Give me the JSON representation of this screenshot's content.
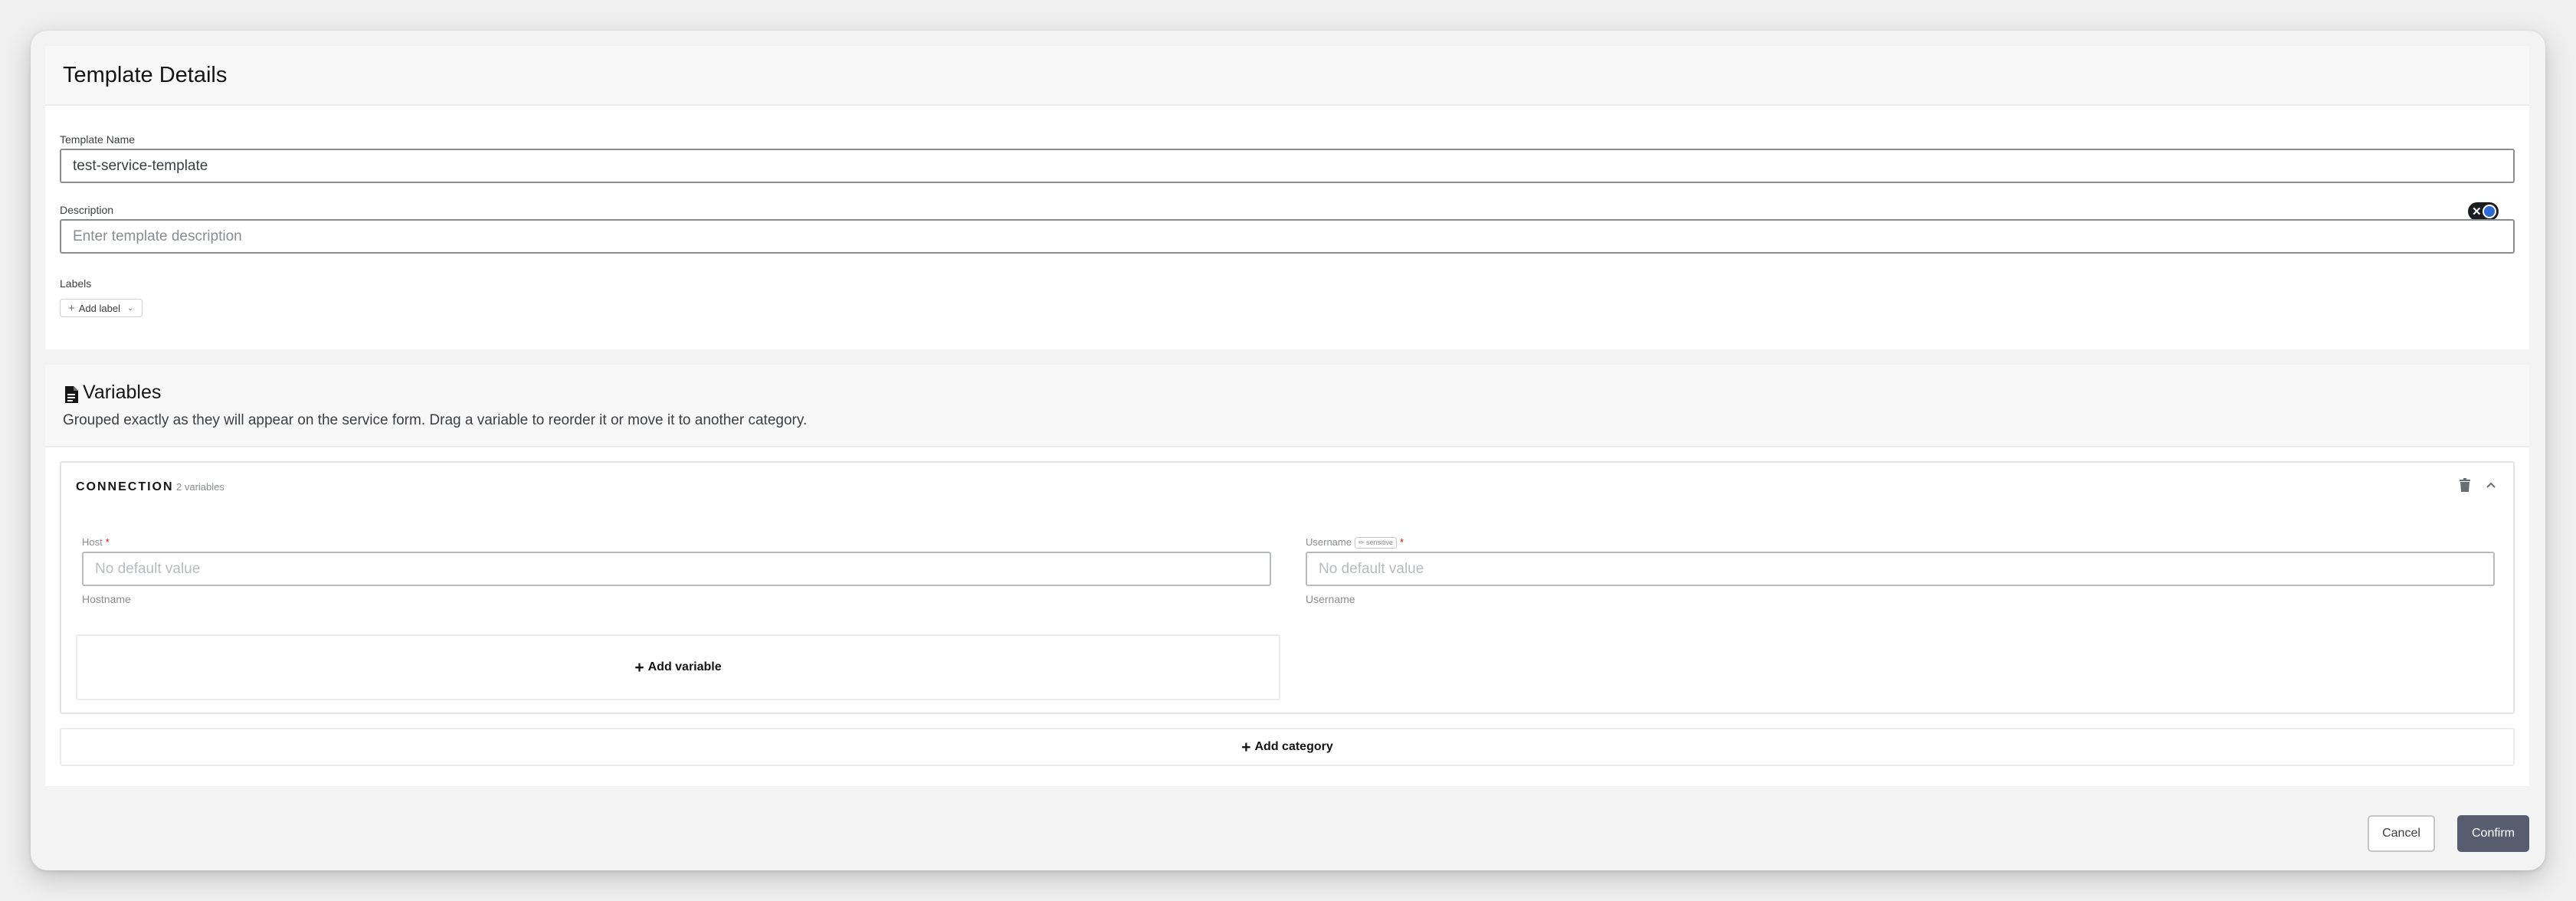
{
  "details": {
    "title": "Template Details",
    "name_label": "Template Name",
    "name_value": "test-service-template",
    "description_label": "Description",
    "description_placeholder": "Enter template description",
    "labels_label": "Labels",
    "add_label": "Add label"
  },
  "variables": {
    "title": "Variables",
    "subtitle": "Grouped exactly as they will appear on the service form. Drag a variable to reorder it or move it to another category.",
    "category": {
      "name": "CONNECTION",
      "count": "2 variables",
      "items": [
        {
          "label": "Host",
          "required": "*",
          "placeholder": "No default value",
          "help": "Hostname"
        },
        {
          "label": "Username",
          "tag": "✏ sensitive",
          "required": "*",
          "placeholder": "No default value",
          "help": "Username"
        }
      ],
      "add_variable": "Add variable"
    },
    "add_category": "Add category"
  },
  "footer": {
    "cancel": "Cancel",
    "confirm": "Confirm"
  },
  "colors": {
    "confirm_bg": "#575d6f",
    "required": "#c9190b"
  }
}
